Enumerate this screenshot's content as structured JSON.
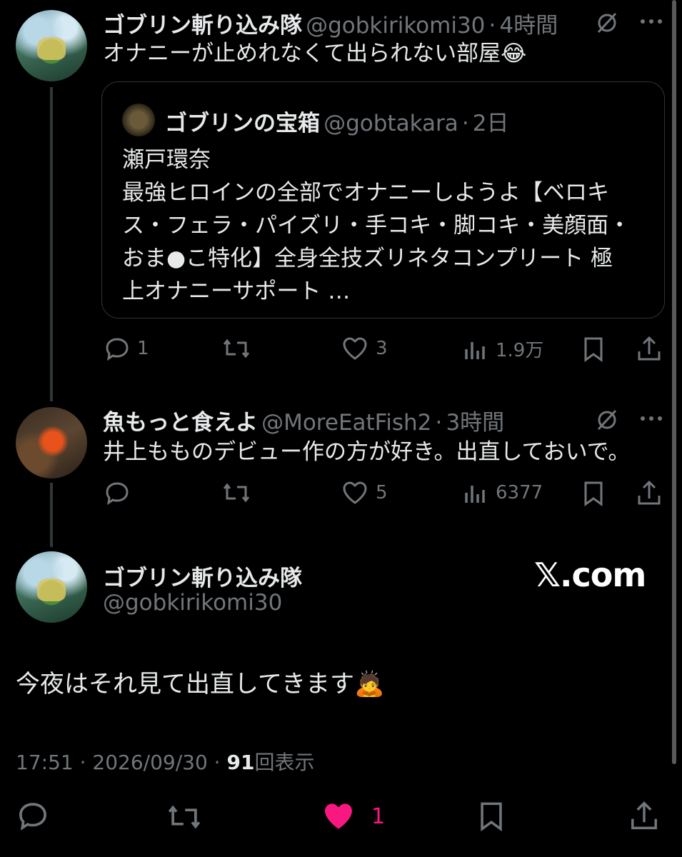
{
  "tweet1": {
    "name": "ゴブリン斬り込み隊",
    "handle": "@gobkirikomi30",
    "time": "4時間",
    "text": "オナニーが止めれなくて出られない部屋😂",
    "quote": {
      "name": "ゴブリンの宝箱",
      "handle": "@gobtakara",
      "time": "2日",
      "lines": [
        "瀬戸環奈",
        "最強ヒロインの全部でオナニーしようよ【ベロキ",
        "ス・フェラ・パイズリ・手コキ・脚コキ・美顔面・",
        "おま●こ特化】全身全技ズリネタコンプリート 極",
        "上オナニーサポート …"
      ]
    },
    "replies": "1",
    "likes": "3",
    "views": "1.9万"
  },
  "tweet2": {
    "name": "魚もっと食えよ",
    "handle": "@MoreEatFish2",
    "time": "3時間",
    "text": "井上もものデビュー作の方が好き。出直しておいで。",
    "likes": "5",
    "views": "6377"
  },
  "main": {
    "name": "ゴブリン斬り込み隊",
    "handle": "@gobkirikomi30",
    "watermark": "𝕏.com",
    "text": "今夜はそれ見て出直してきます🙇",
    "time": "17:51 · 2026/09/30 · ",
    "view_count": "91",
    "view_label": "回表示",
    "likes": "1"
  },
  "sep": "·",
  "colors": {
    "like_active": "#f91880",
    "muted": "#71767b"
  }
}
